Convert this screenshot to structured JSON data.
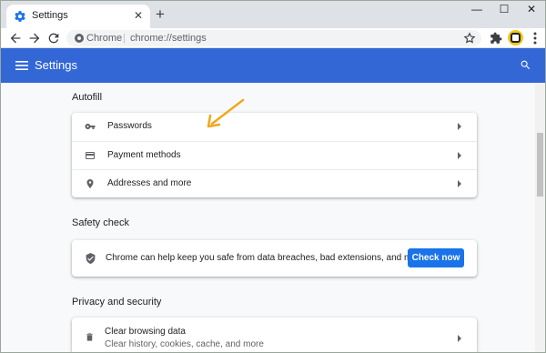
{
  "browser": {
    "tab_title": "Settings",
    "new_tab": "+",
    "tab_close": "✕",
    "window_controls": {
      "minimize": "—",
      "maximize": "☐",
      "close": "✕"
    },
    "omnibox": {
      "scheme_label": "Chrome",
      "separator": "|",
      "url": "chrome://settings"
    }
  },
  "header": {
    "title": "Settings"
  },
  "autofill": {
    "title": "Autofill",
    "items": [
      {
        "label": "Passwords",
        "icon": "key-icon"
      },
      {
        "label": "Payment methods",
        "icon": "credit-card-icon"
      },
      {
        "label": "Addresses and more",
        "icon": "location-pin-icon"
      }
    ]
  },
  "safety_check": {
    "title": "Safety check",
    "text": "Chrome can help keep you safe from data breaches, bad extensions, and more",
    "button": "Check now"
  },
  "privacy": {
    "title": "Privacy and security",
    "items": [
      {
        "label": "Clear browsing data",
        "sublabel": "Clear history, cookies, cache, and more",
        "icon": "trash-icon"
      }
    ]
  },
  "colors": {
    "header": "#3367d6",
    "button": "#1a73e8",
    "annotation": "#f0a81c",
    "profile": "#f5c518"
  }
}
